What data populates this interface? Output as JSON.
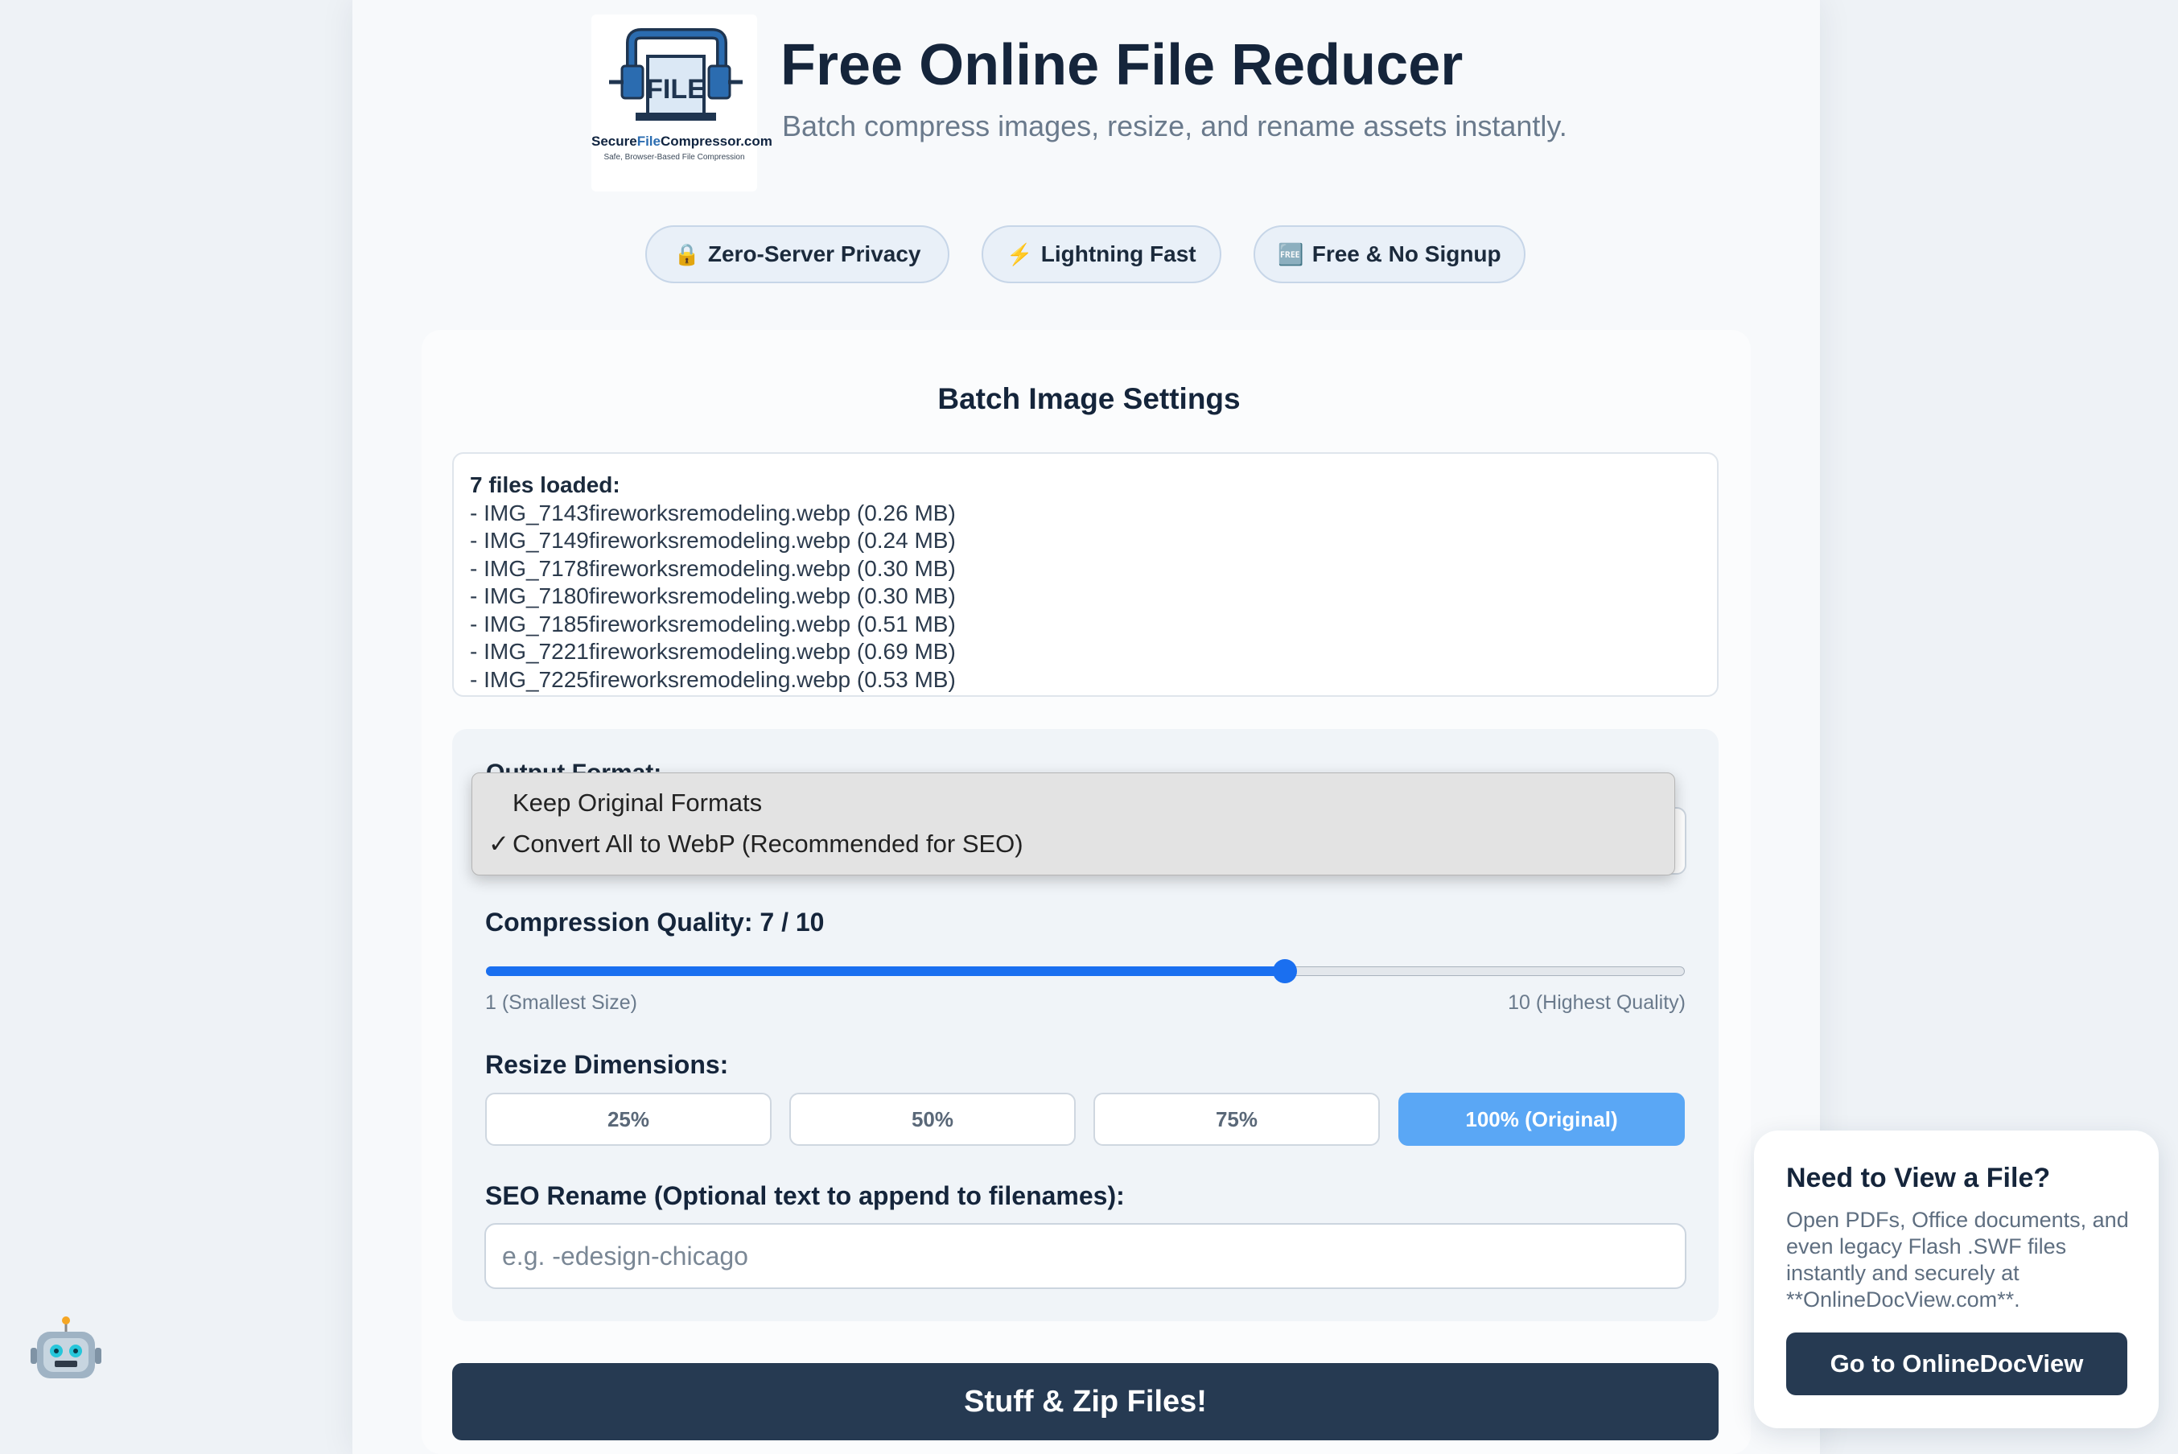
{
  "header": {
    "title": "Free Online File Reducer",
    "subtitle": "Batch compress images, resize, and rename assets instantly.",
    "logo": {
      "name_prefix": "Secure",
      "name_highlight": "File",
      "name_suffix": "Compressor.com",
      "tagline": "Safe, Browser-Based File Compression",
      "icon": "clamp-file-icon"
    }
  },
  "badges": [
    {
      "icon": "lock-icon",
      "glyph": "🔒",
      "label": "Zero-Server Privacy"
    },
    {
      "icon": "lightning-icon",
      "glyph": "⚡",
      "label": "Lightning Fast"
    },
    {
      "icon": "free-icon",
      "glyph": "🆓",
      "label": "Free & No Signup"
    }
  ],
  "settings": {
    "title": "Batch Image Settings",
    "files_header": "7 files loaded:",
    "files": [
      "- IMG_7143fireworksremodeling.webp (0.26 MB)",
      "- IMG_7149fireworksremodeling.webp (0.24 MB)",
      "- IMG_7178fireworksremodeling.webp (0.30 MB)",
      "- IMG_7180fireworksremodeling.webp (0.30 MB)",
      "- IMG_7185fireworksremodeling.webp (0.51 MB)",
      "- IMG_7221fireworksremodeling.webp (0.69 MB)",
      "- IMG_7225fireworksremodeling.webp (0.53 MB)"
    ],
    "output_format": {
      "label": "Output Format:",
      "options": [
        {
          "label": "Keep Original Formats",
          "selected": false
        },
        {
          "label": "Convert All to WebP (Recommended for SEO)",
          "selected": true
        }
      ],
      "check_glyph": "✓"
    },
    "quality": {
      "label": "Compression Quality: 7 / 10",
      "value": 7,
      "min": 1,
      "max": 10,
      "min_label": "1 (Smallest Size)",
      "max_label": "10 (Highest Quality)"
    },
    "resize": {
      "label": "Resize Dimensions:",
      "options": [
        "25%",
        "50%",
        "75%",
        "100% (Original)"
      ],
      "active_index": 3
    },
    "rename": {
      "label": "SEO Rename (Optional text to append to filenames):",
      "placeholder": "e.g. -edesign-chicago",
      "value": ""
    },
    "submit_label": "Stuff & Zip Files!"
  },
  "promo": {
    "title": "Need to View a File?",
    "text": "Open PDFs, Office documents, and even legacy Flash .SWF files instantly and securely at **OnlineDocView.com**.",
    "button_label": "Go to OnlineDocView"
  },
  "colors": {
    "accent": "#1a6ff0",
    "active_button": "#5aa7f5",
    "dark_button": "#263a52",
    "title": "#15253b"
  }
}
